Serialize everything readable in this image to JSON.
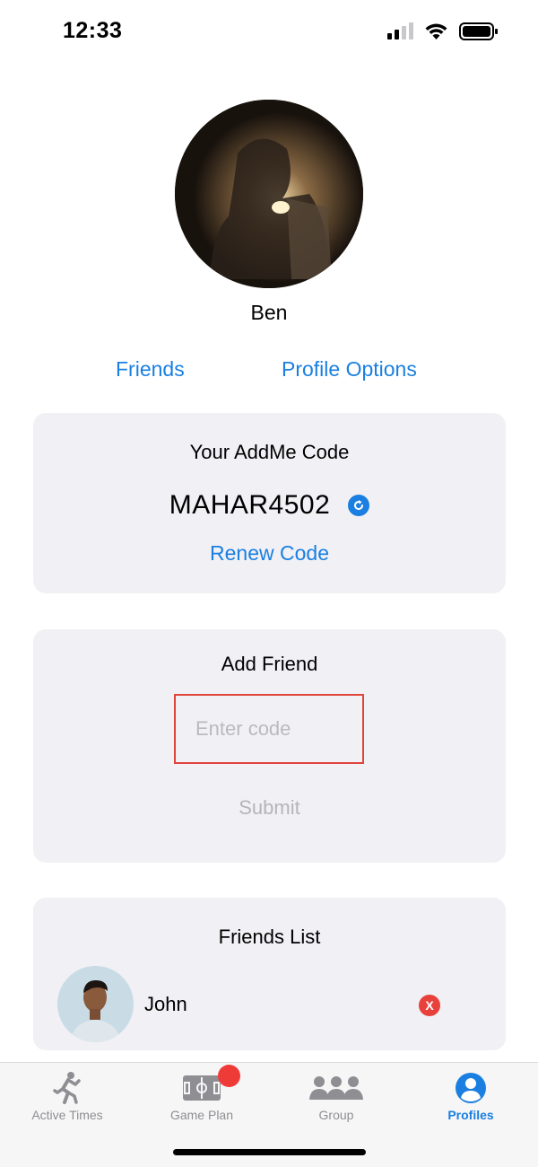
{
  "status_bar": {
    "time": "12:33"
  },
  "profile": {
    "name": "Ben"
  },
  "links": {
    "friends": "Friends",
    "profile_options": "Profile Options"
  },
  "addme_card": {
    "title": "Your AddMe Code",
    "code": "MAHAR4502",
    "renew_label": "Renew Code"
  },
  "add_friend_card": {
    "title": "Add Friend",
    "input_placeholder": "Enter code",
    "input_value": "",
    "submit_label": "Submit"
  },
  "friends_list": {
    "title": "Friends List",
    "items": [
      {
        "name": "John",
        "remove_label": "X"
      }
    ]
  },
  "tab_bar": {
    "tabs": [
      {
        "label": "Active Times",
        "icon": "running-person-icon"
      },
      {
        "label": "Game Plan",
        "icon": "field-plan-icon"
      },
      {
        "label": "Group",
        "icon": "group-icon"
      },
      {
        "label": "Profiles",
        "icon": "profile-icon"
      }
    ],
    "active_index": 3
  },
  "colors": {
    "accent": "#1a7fe0",
    "badge": "#ef3b38",
    "input_border": "#e0443a",
    "card_bg": "#f1f1f5"
  }
}
